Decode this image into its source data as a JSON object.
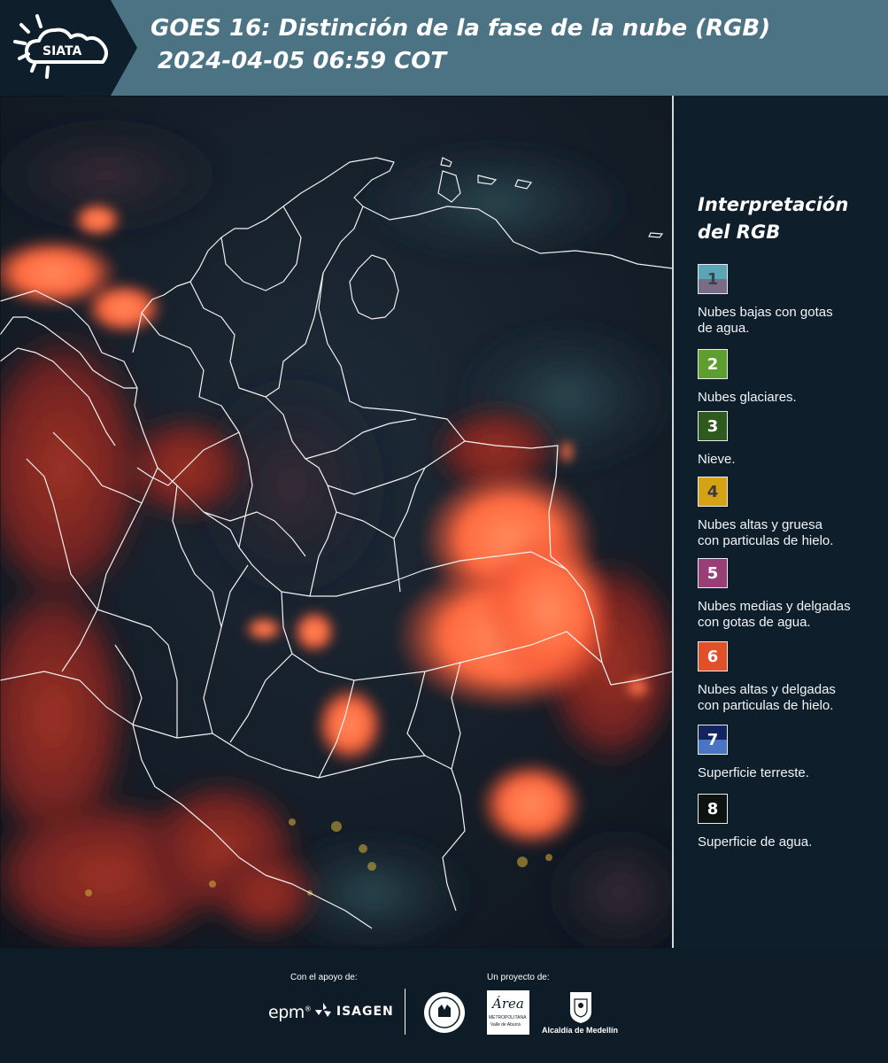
{
  "header": {
    "logo_text": "SIATA",
    "title_line1": "GOES 16: Distinción de la fase de la nube (RGB)",
    "title_line2": "2024-04-05 06:59 COT"
  },
  "legend": {
    "title_line1": "Interpretación",
    "title_line2": "del RGB",
    "items": [
      {
        "number": "1",
        "label_line1": "Nubes bajas con gotas",
        "label_line2": "de agua.",
        "top_color": "#5aa6b6",
        "bottom_color": "#7a6b86",
        "num_color": "#3a3f4a"
      },
      {
        "number": "2",
        "label_line1": "Nubes glaciares.",
        "label_line2": "",
        "top_color": "#5e9e2e",
        "bottom_color": "#5e9e2e",
        "num_color": "#ffffff"
      },
      {
        "number": "3",
        "label_line1": "Nieve.",
        "label_line2": "",
        "top_color": "#2e5a1e",
        "bottom_color": "#2e5a1e",
        "num_color": "#ffffff"
      },
      {
        "number": "4",
        "label_line1": "Nubes altas y gruesa",
        "label_line2": "con particulas de hielo.",
        "top_color": "#d5a215",
        "bottom_color": "#d5a215",
        "num_color": "#3a3a3a"
      },
      {
        "number": "5",
        "label_line1": "Nubes medias y delgadas",
        "label_line2": "con gotas de agua.",
        "top_color": "#9a3e78",
        "bottom_color": "#9a3e78",
        "num_color": "#ffffff"
      },
      {
        "number": "6",
        "label_line1": "Nubes altas y delgadas",
        "label_line2": "con particulas de hielo.",
        "top_color": "#e2502a",
        "bottom_color": "#e2502a",
        "num_color": "#ffffff"
      },
      {
        "number": "7",
        "label_line1": "Superficie terreste.",
        "label_line2": "",
        "top_color": "#14245e",
        "bottom_color": "#4a74c4",
        "num_color": "#ffffff"
      },
      {
        "number": "8",
        "label_line1": "Superficie de agua.",
        "label_line2": "",
        "top_color": "#0b1410",
        "bottom_color": "#0b1410",
        "num_color": "#ffffff"
      }
    ]
  },
  "footer": {
    "support_caption": "Con el apoyo de:",
    "project_caption": "Un proyecto de:",
    "epm_text": "epm",
    "isagen_text": "ISAGEN",
    "area_text": "Área",
    "metro_text": "METROPOLITANA",
    "valle_text": "Valle de Aburrá",
    "alcaldia_text": "Alcaldía de Medellín"
  },
  "colors": {
    "header_bg": "#4b7384",
    "logo_bg": "#0f1e2b",
    "footer_bg": "#0e1c27",
    "cloud_red": "#e5452c",
    "cloud_orange": "#ff7a4a"
  }
}
